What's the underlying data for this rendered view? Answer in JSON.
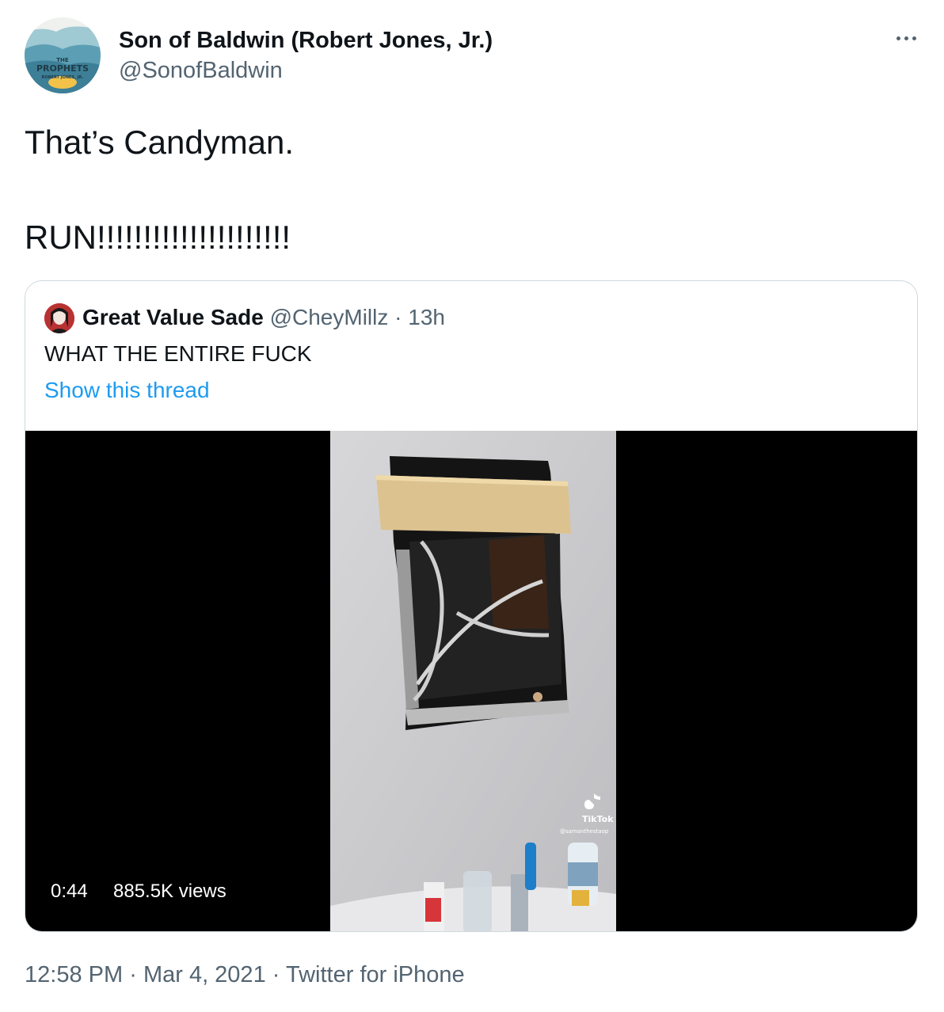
{
  "tweet": {
    "author_name": "Son of Baldwin (Robert Jones, Jr.)",
    "author_handle": "@SonofBaldwin",
    "avatar": {
      "icon": "book-cover-avatar",
      "title_line1": "THE",
      "title_line2": "PROPHETS",
      "subtitle": "ROBERT JONES, JR."
    },
    "more_icon": "more-options-icon",
    "text_line1": "That’s Candyman.",
    "text_line2": "RUN!!!!!!!!!!!!!!!!!!!!!"
  },
  "quote": {
    "author_name": "Great Value Sade",
    "author_handle": "@CheyMillz",
    "separator": "·",
    "time": "13h",
    "text": "WHAT THE ENTIRE FUCK",
    "show_thread": "Show this thread",
    "video": {
      "duration": "0:44",
      "views": "885.5K views",
      "watermark_brand": "TikTok",
      "watermark_user": "@samanthestaop"
    }
  },
  "meta": {
    "time": "12:58 PM",
    "sep1": "·",
    "date": "Mar 4, 2021",
    "sep2": "·",
    "source": "Twitter for iPhone"
  },
  "colors": {
    "text_primary": "#0f1419",
    "text_secondary": "#536471",
    "link_blue": "#1d9bf0",
    "border": "#cfd9de"
  }
}
